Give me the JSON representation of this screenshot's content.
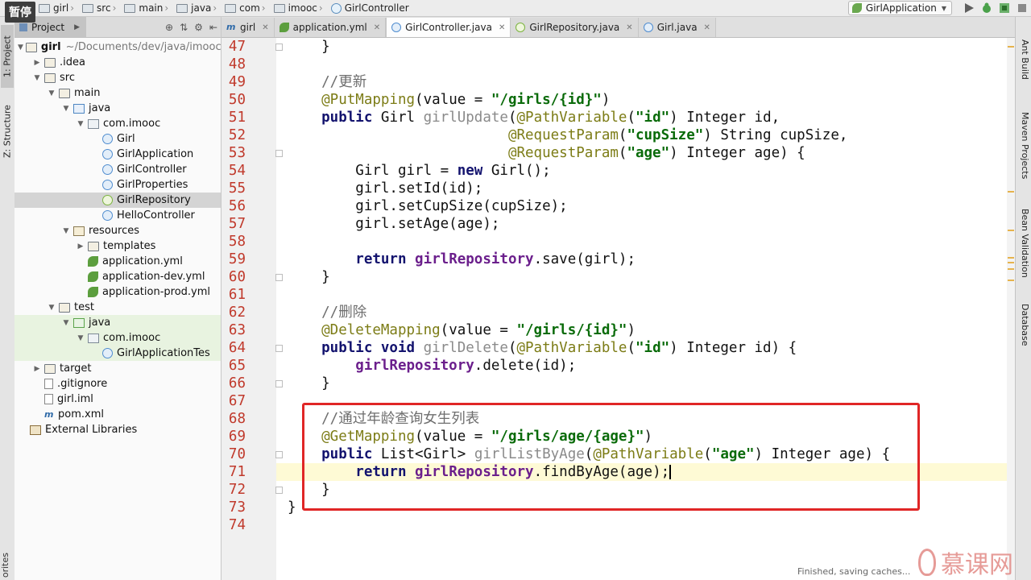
{
  "overlay": {
    "pause_label": "暂停"
  },
  "breadcrumb": [
    "girl",
    "src",
    "main",
    "java",
    "com",
    "imooc",
    "GirlController"
  ],
  "run_config": {
    "label": "GirlApplication"
  },
  "toolbar_icons": [
    "run-icon",
    "debug-icon",
    "coverage-icon",
    "stop-icon"
  ],
  "left_strip": {
    "project_label": "1: Project",
    "structure_label": "Z: Structure",
    "favorites_label": "orites"
  },
  "project_panel": {
    "tab_label": "Project",
    "tree": [
      {
        "label": "girl",
        "muted": "~/Documents/dev/java/imooc/",
        "icon": "folder",
        "depth": 0,
        "arrow": "▼",
        "bold": true
      },
      {
        "label": ".idea",
        "icon": "folder",
        "depth": 1,
        "arrow": "▶"
      },
      {
        "label": "src",
        "icon": "folder",
        "depth": 1,
        "arrow": "▼"
      },
      {
        "label": "main",
        "icon": "folder",
        "depth": 2,
        "arrow": "▼"
      },
      {
        "label": "java",
        "icon": "folder-src",
        "depth": 3,
        "arrow": "▼"
      },
      {
        "label": "com.imooc",
        "icon": "pkg",
        "depth": 4,
        "arrow": "▼"
      },
      {
        "label": "Girl",
        "icon": "cls",
        "depth": 5
      },
      {
        "label": "GirlApplication",
        "icon": "cls",
        "depth": 5
      },
      {
        "label": "GirlController",
        "icon": "cls",
        "depth": 5
      },
      {
        "label": "GirlProperties",
        "icon": "cls",
        "depth": 5
      },
      {
        "label": "GirlRepository",
        "icon": "intf",
        "depth": 5,
        "selected": true
      },
      {
        "label": "HelloController",
        "icon": "cls",
        "depth": 5
      },
      {
        "label": "resources",
        "icon": "folder-res",
        "depth": 3,
        "arrow": "▼"
      },
      {
        "label": "templates",
        "icon": "folder",
        "depth": 4,
        "arrow": "▶"
      },
      {
        "label": "application.yml",
        "icon": "yml",
        "depth": 4
      },
      {
        "label": "application-dev.yml",
        "icon": "yml",
        "depth": 4
      },
      {
        "label": "application-prod.yml",
        "icon": "yml",
        "depth": 4
      },
      {
        "label": "test",
        "icon": "folder",
        "depth": 2,
        "arrow": "▼"
      },
      {
        "label": "java",
        "icon": "folder-test",
        "depth": 3,
        "arrow": "▼",
        "test": true
      },
      {
        "label": "com.imooc",
        "icon": "pkg",
        "depth": 4,
        "arrow": "▼",
        "test": true
      },
      {
        "label": "GirlApplicationTes",
        "icon": "cls",
        "depth": 5,
        "test": true
      },
      {
        "label": "target",
        "icon": "folder",
        "depth": 1,
        "arrow": "▶"
      },
      {
        "label": ".gitignore",
        "icon": "file",
        "depth": 1
      },
      {
        "label": "girl.iml",
        "icon": "file",
        "depth": 1
      },
      {
        "label": "pom.xml",
        "icon": "xml",
        "depth": 1
      },
      {
        "label": "External Libraries",
        "icon": "lib",
        "depth": 0
      }
    ]
  },
  "editor_tabs": [
    {
      "label": "girl",
      "icon": "m",
      "active": false
    },
    {
      "label": "application.yml",
      "icon": "yml",
      "active": false
    },
    {
      "label": "GirlController.java",
      "icon": "cls",
      "active": true
    },
    {
      "label": "GirlRepository.java",
      "icon": "intf",
      "active": false
    },
    {
      "label": "Girl.java",
      "icon": "cls",
      "active": false
    }
  ],
  "editor": {
    "current_line": 71,
    "lines": [
      {
        "n": 47,
        "tokens": [
          [
            "",
            "    }"
          ]
        ]
      },
      {
        "n": 48,
        "tokens": []
      },
      {
        "n": 49,
        "tokens": [
          [
            "cmt",
            "    //更新"
          ]
        ]
      },
      {
        "n": 50,
        "tokens": [
          [
            "ann",
            "    @PutMapping"
          ],
          [
            "",
            "(value = "
          ],
          [
            "str",
            "\"/girls/{id}\""
          ],
          [
            "",
            ")"
          ]
        ]
      },
      {
        "n": 51,
        "tokens": [
          [
            "kw",
            "    public "
          ],
          [
            "",
            "Girl "
          ],
          [
            "unused",
            "girlUpdate"
          ],
          [
            "",
            "("
          ],
          [
            "ann",
            "@PathVariable"
          ],
          [
            "",
            "("
          ],
          [
            "str",
            "\"id\""
          ],
          [
            "",
            ") Integer id,"
          ]
        ]
      },
      {
        "n": 52,
        "tokens": [
          [
            "",
            "                          "
          ],
          [
            "ann",
            "@RequestParam"
          ],
          [
            "",
            "("
          ],
          [
            "str",
            "\"cupSize\""
          ],
          [
            "",
            ") String cupSize,"
          ]
        ]
      },
      {
        "n": 53,
        "tokens": [
          [
            "",
            "                          "
          ],
          [
            "ann",
            "@RequestParam"
          ],
          [
            "",
            "("
          ],
          [
            "str",
            "\"age\""
          ],
          [
            "",
            ") Integer age) {"
          ]
        ]
      },
      {
        "n": 54,
        "tokens": [
          [
            "",
            "        Girl girl = "
          ],
          [
            "kw",
            "new "
          ],
          [
            "",
            "Girl();"
          ]
        ]
      },
      {
        "n": 55,
        "tokens": [
          [
            "",
            "        girl.setId(id);"
          ]
        ]
      },
      {
        "n": 56,
        "tokens": [
          [
            "",
            "        girl.setCupSize(cupSize);"
          ]
        ]
      },
      {
        "n": 57,
        "tokens": [
          [
            "",
            "        girl.setAge(age);"
          ]
        ]
      },
      {
        "n": 58,
        "tokens": []
      },
      {
        "n": 59,
        "tokens": [
          [
            "kw",
            "        return "
          ],
          [
            "field",
            "girlRepository"
          ],
          [
            "",
            ".save(girl);"
          ]
        ]
      },
      {
        "n": 60,
        "tokens": [
          [
            "",
            "    }"
          ]
        ]
      },
      {
        "n": 61,
        "tokens": []
      },
      {
        "n": 62,
        "tokens": [
          [
            "cmt",
            "    //删除"
          ]
        ]
      },
      {
        "n": 63,
        "tokens": [
          [
            "ann",
            "    @DeleteMapping"
          ],
          [
            "",
            "(value = "
          ],
          [
            "str",
            "\"/girls/{id}\""
          ],
          [
            "",
            ")"
          ]
        ]
      },
      {
        "n": 64,
        "tokens": [
          [
            "kw",
            "    public void "
          ],
          [
            "unused",
            "girlDelete"
          ],
          [
            "",
            "("
          ],
          [
            "ann",
            "@PathVariable"
          ],
          [
            "",
            "("
          ],
          [
            "str",
            "\"id\""
          ],
          [
            "",
            ") Integer id) {"
          ]
        ]
      },
      {
        "n": 65,
        "tokens": [
          [
            "field",
            "        girlRepository"
          ],
          [
            "",
            ".delete(id);"
          ]
        ]
      },
      {
        "n": 66,
        "tokens": [
          [
            "",
            "    }"
          ]
        ]
      },
      {
        "n": 67,
        "tokens": []
      },
      {
        "n": 68,
        "tokens": [
          [
            "cmt",
            "    //通过年龄查询女生列表"
          ]
        ]
      },
      {
        "n": 69,
        "tokens": [
          [
            "ann",
            "    @GetMapping"
          ],
          [
            "",
            "(value = "
          ],
          [
            "str",
            "\"/girls/age/{age}\""
          ],
          [
            "",
            ")"
          ]
        ]
      },
      {
        "n": 70,
        "tokens": [
          [
            "kw",
            "    public "
          ],
          [
            "",
            "List<Girl> "
          ],
          [
            "unused",
            "girlListByAge"
          ],
          [
            "",
            "("
          ],
          [
            "ann",
            "@PathVariable"
          ],
          [
            "",
            "("
          ],
          [
            "str",
            "\"age\""
          ],
          [
            "",
            ") Integer age) {"
          ]
        ]
      },
      {
        "n": 71,
        "tokens": [
          [
            "kw",
            "        return "
          ],
          [
            "field",
            "girlRepository"
          ],
          [
            "",
            ".findByAge(age);"
          ]
        ]
      },
      {
        "n": 72,
        "tokens": [
          [
            "",
            "    }"
          ]
        ]
      },
      {
        "n": 73,
        "tokens": [
          [
            "",
            "}"
          ]
        ]
      },
      {
        "n": 74,
        "tokens": []
      }
    ]
  },
  "right_strip": {
    "ant_build": "Ant Build",
    "maven": "Maven Projects",
    "bean": "Bean Validation",
    "database": "Database"
  },
  "status": {
    "text": "Finished, saving caches..."
  },
  "watermark": {
    "text": "慕课网"
  }
}
